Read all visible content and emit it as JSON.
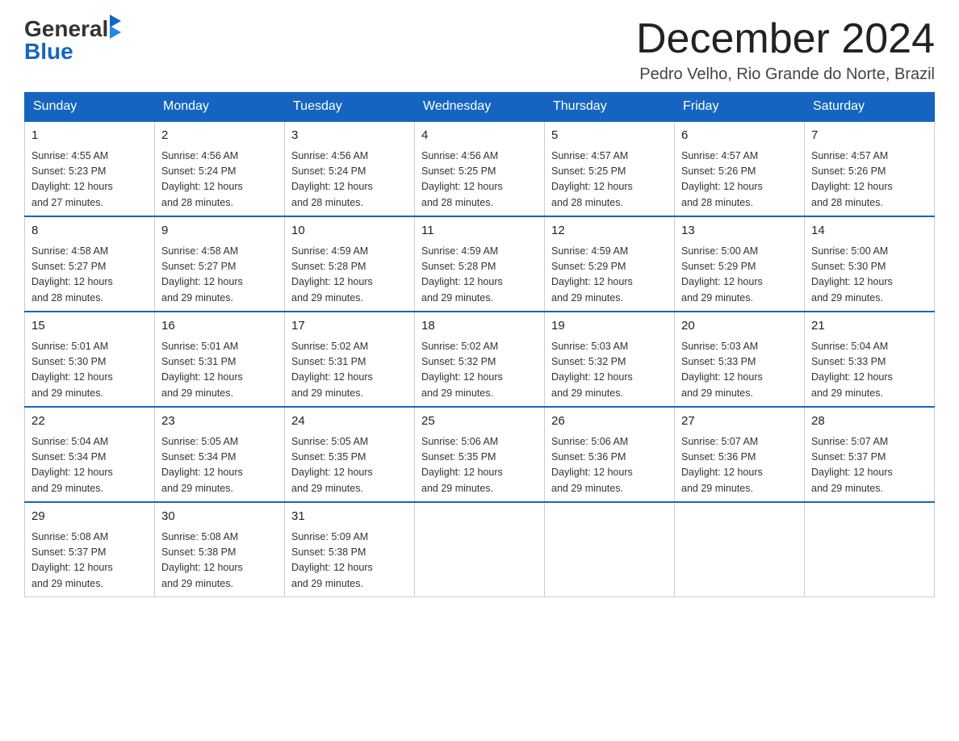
{
  "header": {
    "logo_general": "General",
    "logo_blue": "Blue",
    "month": "December 2024",
    "location": "Pedro Velho, Rio Grande do Norte, Brazil"
  },
  "days_of_week": [
    "Sunday",
    "Monday",
    "Tuesday",
    "Wednesday",
    "Thursday",
    "Friday",
    "Saturday"
  ],
  "weeks": [
    [
      {
        "day": "1",
        "sunrise": "4:55 AM",
        "sunset": "5:23 PM",
        "daylight": "12 hours and 27 minutes."
      },
      {
        "day": "2",
        "sunrise": "4:56 AM",
        "sunset": "5:24 PM",
        "daylight": "12 hours and 28 minutes."
      },
      {
        "day": "3",
        "sunrise": "4:56 AM",
        "sunset": "5:24 PM",
        "daylight": "12 hours and 28 minutes."
      },
      {
        "day": "4",
        "sunrise": "4:56 AM",
        "sunset": "5:25 PM",
        "daylight": "12 hours and 28 minutes."
      },
      {
        "day": "5",
        "sunrise": "4:57 AM",
        "sunset": "5:25 PM",
        "daylight": "12 hours and 28 minutes."
      },
      {
        "day": "6",
        "sunrise": "4:57 AM",
        "sunset": "5:26 PM",
        "daylight": "12 hours and 28 minutes."
      },
      {
        "day": "7",
        "sunrise": "4:57 AM",
        "sunset": "5:26 PM",
        "daylight": "12 hours and 28 minutes."
      }
    ],
    [
      {
        "day": "8",
        "sunrise": "4:58 AM",
        "sunset": "5:27 PM",
        "daylight": "12 hours and 28 minutes."
      },
      {
        "day": "9",
        "sunrise": "4:58 AM",
        "sunset": "5:27 PM",
        "daylight": "12 hours and 29 minutes."
      },
      {
        "day": "10",
        "sunrise": "4:59 AM",
        "sunset": "5:28 PM",
        "daylight": "12 hours and 29 minutes."
      },
      {
        "day": "11",
        "sunrise": "4:59 AM",
        "sunset": "5:28 PM",
        "daylight": "12 hours and 29 minutes."
      },
      {
        "day": "12",
        "sunrise": "4:59 AM",
        "sunset": "5:29 PM",
        "daylight": "12 hours and 29 minutes."
      },
      {
        "day": "13",
        "sunrise": "5:00 AM",
        "sunset": "5:29 PM",
        "daylight": "12 hours and 29 minutes."
      },
      {
        "day": "14",
        "sunrise": "5:00 AM",
        "sunset": "5:30 PM",
        "daylight": "12 hours and 29 minutes."
      }
    ],
    [
      {
        "day": "15",
        "sunrise": "5:01 AM",
        "sunset": "5:30 PM",
        "daylight": "12 hours and 29 minutes."
      },
      {
        "day": "16",
        "sunrise": "5:01 AM",
        "sunset": "5:31 PM",
        "daylight": "12 hours and 29 minutes."
      },
      {
        "day": "17",
        "sunrise": "5:02 AM",
        "sunset": "5:31 PM",
        "daylight": "12 hours and 29 minutes."
      },
      {
        "day": "18",
        "sunrise": "5:02 AM",
        "sunset": "5:32 PM",
        "daylight": "12 hours and 29 minutes."
      },
      {
        "day": "19",
        "sunrise": "5:03 AM",
        "sunset": "5:32 PM",
        "daylight": "12 hours and 29 minutes."
      },
      {
        "day": "20",
        "sunrise": "5:03 AM",
        "sunset": "5:33 PM",
        "daylight": "12 hours and 29 minutes."
      },
      {
        "day": "21",
        "sunrise": "5:04 AM",
        "sunset": "5:33 PM",
        "daylight": "12 hours and 29 minutes."
      }
    ],
    [
      {
        "day": "22",
        "sunrise": "5:04 AM",
        "sunset": "5:34 PM",
        "daylight": "12 hours and 29 minutes."
      },
      {
        "day": "23",
        "sunrise": "5:05 AM",
        "sunset": "5:34 PM",
        "daylight": "12 hours and 29 minutes."
      },
      {
        "day": "24",
        "sunrise": "5:05 AM",
        "sunset": "5:35 PM",
        "daylight": "12 hours and 29 minutes."
      },
      {
        "day": "25",
        "sunrise": "5:06 AM",
        "sunset": "5:35 PM",
        "daylight": "12 hours and 29 minutes."
      },
      {
        "day": "26",
        "sunrise": "5:06 AM",
        "sunset": "5:36 PM",
        "daylight": "12 hours and 29 minutes."
      },
      {
        "day": "27",
        "sunrise": "5:07 AM",
        "sunset": "5:36 PM",
        "daylight": "12 hours and 29 minutes."
      },
      {
        "day": "28",
        "sunrise": "5:07 AM",
        "sunset": "5:37 PM",
        "daylight": "12 hours and 29 minutes."
      }
    ],
    [
      {
        "day": "29",
        "sunrise": "5:08 AM",
        "sunset": "5:37 PM",
        "daylight": "12 hours and 29 minutes."
      },
      {
        "day": "30",
        "sunrise": "5:08 AM",
        "sunset": "5:38 PM",
        "daylight": "12 hours and 29 minutes."
      },
      {
        "day": "31",
        "sunrise": "5:09 AM",
        "sunset": "5:38 PM",
        "daylight": "12 hours and 29 minutes."
      },
      null,
      null,
      null,
      null
    ]
  ],
  "labels": {
    "sunrise": "Sunrise:",
    "sunset": "Sunset:",
    "daylight": "Daylight:"
  }
}
